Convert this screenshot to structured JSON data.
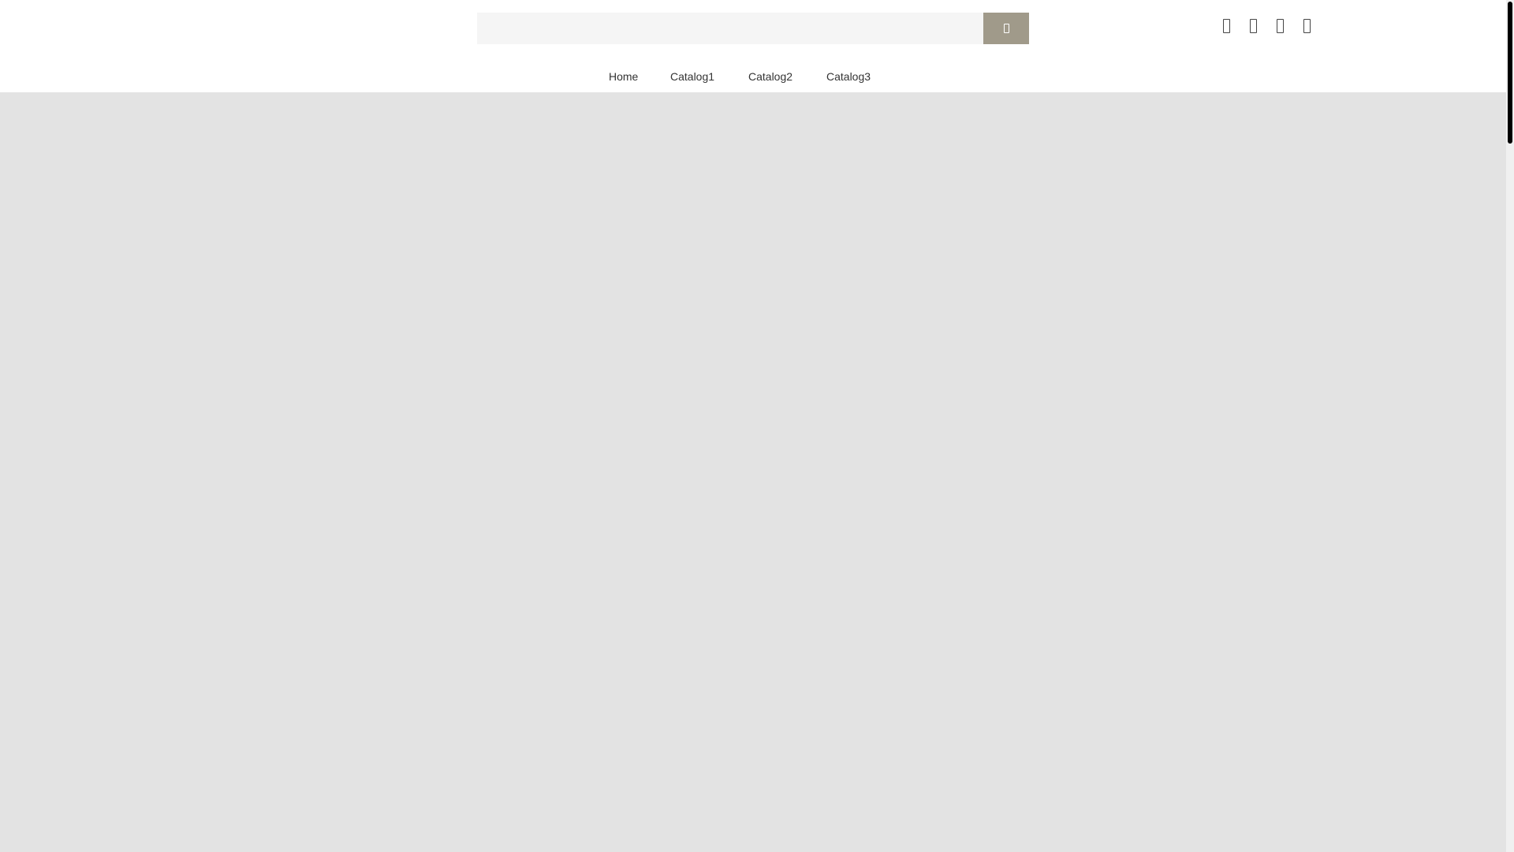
{
  "search": {
    "placeholder": "",
    "value": "",
    "button_icon": "search-icon"
  },
  "header_icons": [
    {
      "name": "user-icon"
    },
    {
      "name": "heart-icon"
    },
    {
      "name": "compare-icon"
    },
    {
      "name": "cart-icon"
    }
  ],
  "nav": {
    "items": [
      {
        "label": "Home"
      },
      {
        "label": "Catalog1"
      },
      {
        "label": "Catalog2"
      },
      {
        "label": "Catalog3"
      }
    ]
  },
  "colors": {
    "search_button": "#a09a8a",
    "search_field": "#f5f5f5",
    "content_background": "#e3e3e3",
    "header_background": "#ffffff"
  }
}
